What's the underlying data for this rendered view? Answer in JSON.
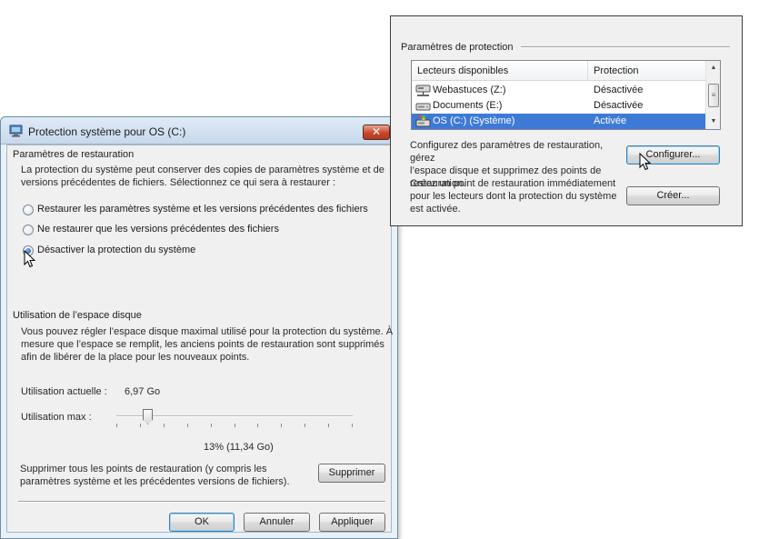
{
  "dialog": {
    "title": "Protection système pour OS (C:)",
    "close_label": "✕",
    "restore_group": {
      "title": "Paramètres de restauration",
      "description_line1": "La protection du système peut conserver des copies de paramètres système et de",
      "description_line2": "versions précédentes de fichiers. Sélectionnez ce qui sera à restaurer :",
      "options": [
        {
          "label": "Restaurer les paramètres système et les versions précédentes des fichiers",
          "checked": false
        },
        {
          "label": "Ne restaurer que les versions précédentes des fichiers",
          "checked": false
        },
        {
          "label": "Désactiver la protection du système",
          "checked": true
        }
      ]
    },
    "disk_group": {
      "title": "Utilisation de l’espace disque",
      "description_line1": "Vous pouvez régler l’espace disque maximal utilisé pour la protection du système. À",
      "description_line2": "mesure que l’espace se remplit, les anciens points de restauration sont supprimés",
      "description_line3": "afin de libérer de la place pour les nouveaux points.",
      "current_usage_label": "Utilisation actuelle :",
      "current_usage_value": "6,97 Go",
      "max_usage_label": "Utilisation max :",
      "max_usage_fraction": 0.13,
      "max_usage_value": "13% (11,34 Go)",
      "delete_text_line1": "Supprimer tous les points de restauration (y compris les",
      "delete_text_line2": "paramètres système et les précédentes versions de fichiers).",
      "delete_button": "Supprimer"
    },
    "buttons": {
      "ok": "OK",
      "cancel": "Annuler",
      "apply": "Appliquer"
    }
  },
  "protection_panel": {
    "title": "Paramètres de protection",
    "columns": {
      "drives": "Lecteurs disponibles",
      "protection": "Protection"
    },
    "drives": [
      {
        "name": "Webastuces (Z:)",
        "status": "Désactivée",
        "icon": "network-drive-icon",
        "selected": false
      },
      {
        "name": "Documents (E:)",
        "status": "Désactivée",
        "icon": "hard-drive-icon",
        "selected": false
      },
      {
        "name": "OS (C:) (Système)",
        "status": "Activée",
        "icon": "system-drive-icon",
        "selected": true
      }
    ],
    "configure_text_line1": "Configurez des paramètres de restauration, gérez",
    "configure_text_line2": "l’espace disque et supprimez des points de",
    "configure_text_line3": "restauration.",
    "configure_button": "Configurer...",
    "create_text_line1": "Créez un point de restauration immédiatement",
    "create_text_line2": "pour les lecteurs dont la protection du système",
    "create_text_line3": "est activée.",
    "create_button": "Créer..."
  },
  "colors": {
    "selection": "#3d7ad6",
    "close_button": "#c8452a",
    "accent": "#3c7fb1"
  }
}
